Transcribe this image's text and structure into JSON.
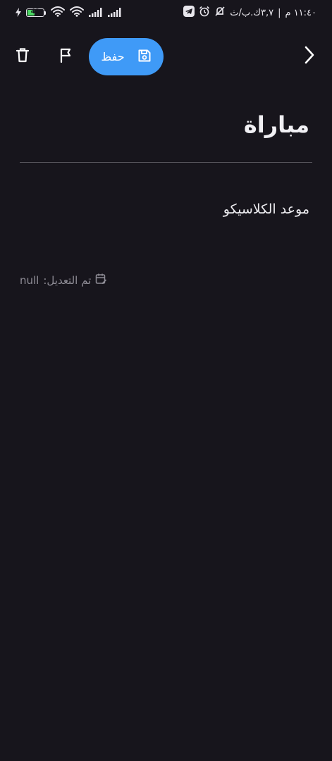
{
  "status_bar": {
    "time": "١١:٤٠ م",
    "network_speed": "٣,٧ك.ب/ث",
    "separator": "|",
    "battery_level": "42",
    "battery_percent": 0.42,
    "icons_right": [
      "telegram-icon",
      "alarm-icon",
      "mute-icon"
    ],
    "icons_left": [
      "charging-icon",
      "battery-icon",
      "wifi-icon",
      "wifi-icon",
      "signal-icon",
      "signal-icon"
    ]
  },
  "toolbar": {
    "save_label": "حفظ",
    "accent": "#3f9af7",
    "icons": [
      "delete-icon",
      "flag-icon",
      "save-icon",
      "back-icon"
    ]
  },
  "note": {
    "title": "مباراة",
    "body": "موعد الكلاسيكو",
    "modified_label": "تم التعديل:",
    "modified_value": "null"
  }
}
